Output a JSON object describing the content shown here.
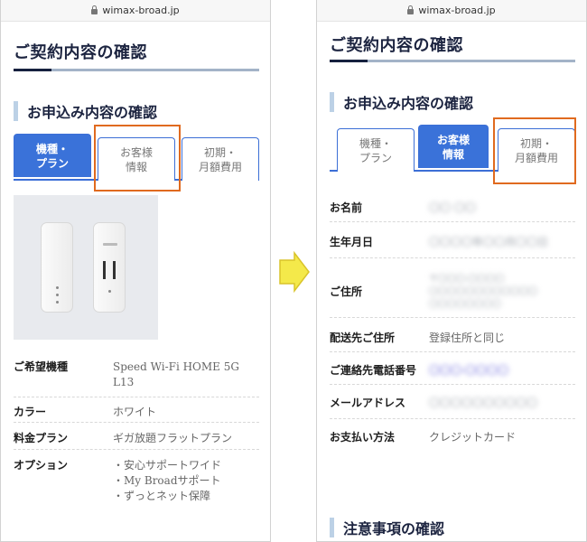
{
  "browser": {
    "url": "wimax-broad.jp"
  },
  "page_title": "ご契約内容の確認",
  "section_title": "お申込み内容の確認",
  "tabs": [
    {
      "label": "機種・\nプラン"
    },
    {
      "label": "お客様\n情報"
    },
    {
      "label": "初期・\n月額費用"
    }
  ],
  "product_rows": [
    {
      "key": "ご希望機種",
      "value": "Speed Wi-Fi HOME 5G\nL13"
    },
    {
      "key": "カラー",
      "value": "ホワイト"
    },
    {
      "key": "料金プラン",
      "value": "ギガ放題フラットプラン"
    },
    {
      "key": "オプション",
      "value": "・安心サポートワイド\n・My Broadサポート\n・ずっとネット保障"
    }
  ],
  "customer_rows": [
    {
      "key": "お名前",
      "value": "〇〇 〇〇"
    },
    {
      "key": "生年月日",
      "value": "〇〇〇〇年〇〇月〇〇日"
    },
    {
      "key": "ご住所",
      "value": "〒〇〇〇-〇〇〇〇\n〇〇〇〇〇〇〇〇〇〇〇〇\n〇〇〇〇〇〇〇〇"
    },
    {
      "key": "配送先ご住所",
      "value": "登録住所と同じ"
    },
    {
      "key": "ご連絡先電話番号",
      "value": "〇〇〇-〇〇〇〇"
    },
    {
      "key": "メールアドレス",
      "value": "〇〇〇〇〇〇〇〇〇〇"
    },
    {
      "key": "お支払い方法",
      "value": "クレジットカード"
    }
  ],
  "notes_section_title": "注意事項の確認",
  "product_brand_text": "5G",
  "colors": {
    "accent_blue": "#3a72d9",
    "navy": "#16213f",
    "highlight_orange": "#e06a1f",
    "arrow_yellow": "#f4e94a"
  }
}
